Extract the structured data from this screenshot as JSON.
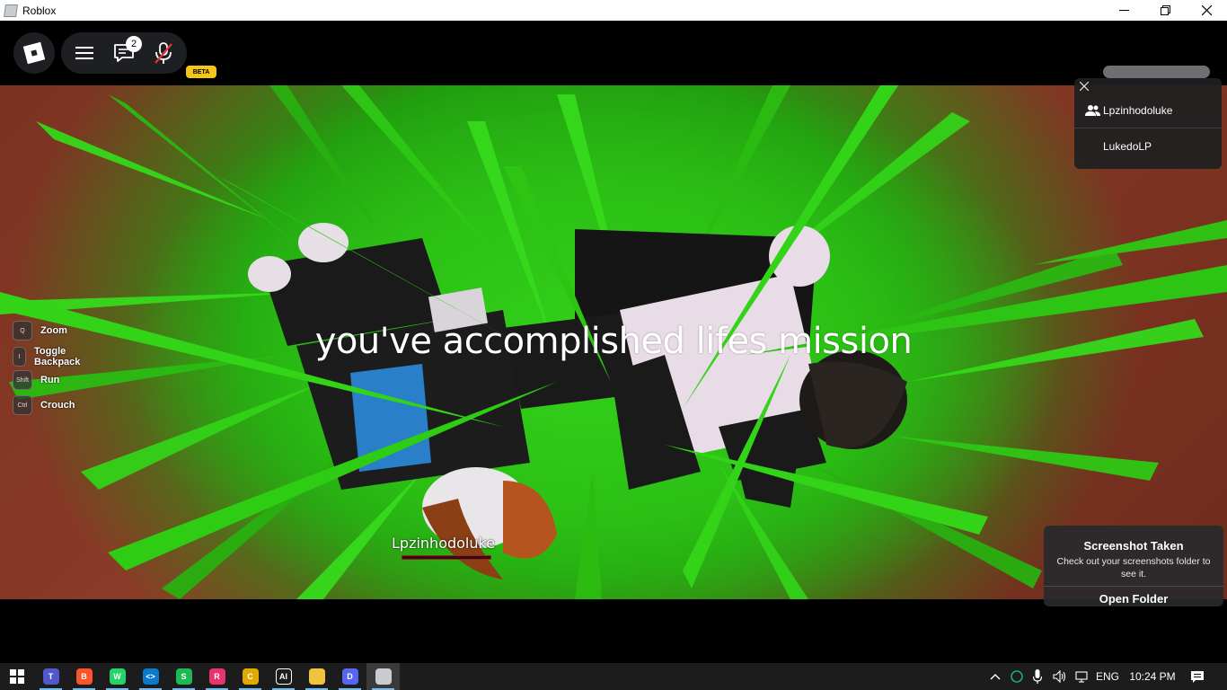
{
  "window": {
    "title": "Roblox",
    "controls": {
      "minimize": "minimize-icon",
      "restore": "restore-icon",
      "close": "close-icon"
    }
  },
  "topbar": {
    "menu_icon": "hamburger-menu-icon",
    "chat_icon": "chat-icon",
    "chat_badge": "2",
    "mic_icon": "mic-muted-icon",
    "beta_label": "BETA"
  },
  "game": {
    "mission_text": "you've accomplished lifes mission",
    "player_nametag": "Lpzinhodoluke",
    "controls": [
      {
        "key": "Q",
        "label": "Zoom"
      },
      {
        "key": "I",
        "label": "Toggle Backpack"
      },
      {
        "key": "Shift",
        "label": "Run"
      },
      {
        "key": "Ctrl",
        "label": "Crouch"
      }
    ]
  },
  "playerlist": {
    "players": [
      {
        "name": "Lpzinhodoluke",
        "icon": "friends-icon"
      },
      {
        "name": "LukedoLP",
        "icon": ""
      }
    ]
  },
  "toast": {
    "title": "Screenshot Taken",
    "body": "Check out your screenshots folder to see it.",
    "button": "Open Folder"
  },
  "taskbar": {
    "apps": [
      {
        "name": "teams",
        "color": "#5059c9",
        "glyph": "T"
      },
      {
        "name": "brave",
        "color": "#fb542b",
        "glyph": "B"
      },
      {
        "name": "whatsapp",
        "color": "#25d366",
        "glyph": "W"
      },
      {
        "name": "vscode",
        "color": "#0a7acc",
        "glyph": "<>"
      },
      {
        "name": "spotify",
        "color": "#1db954",
        "glyph": "S"
      },
      {
        "name": "app",
        "color": "#e8336c",
        "glyph": "R"
      },
      {
        "name": "chrome",
        "color": "#e0a800",
        "glyph": "C"
      },
      {
        "name": "openai",
        "color": "#1c1c1c",
        "glyph": "AI"
      },
      {
        "name": "file-explorer",
        "color": "#f0c33c",
        "glyph": ""
      },
      {
        "name": "discord",
        "color": "#5865f2",
        "glyph": "D"
      },
      {
        "name": "roblox",
        "color": "#c9ccd1",
        "glyph": ""
      }
    ],
    "tray": {
      "language": "ENG",
      "time": "10:24 PM"
    }
  }
}
